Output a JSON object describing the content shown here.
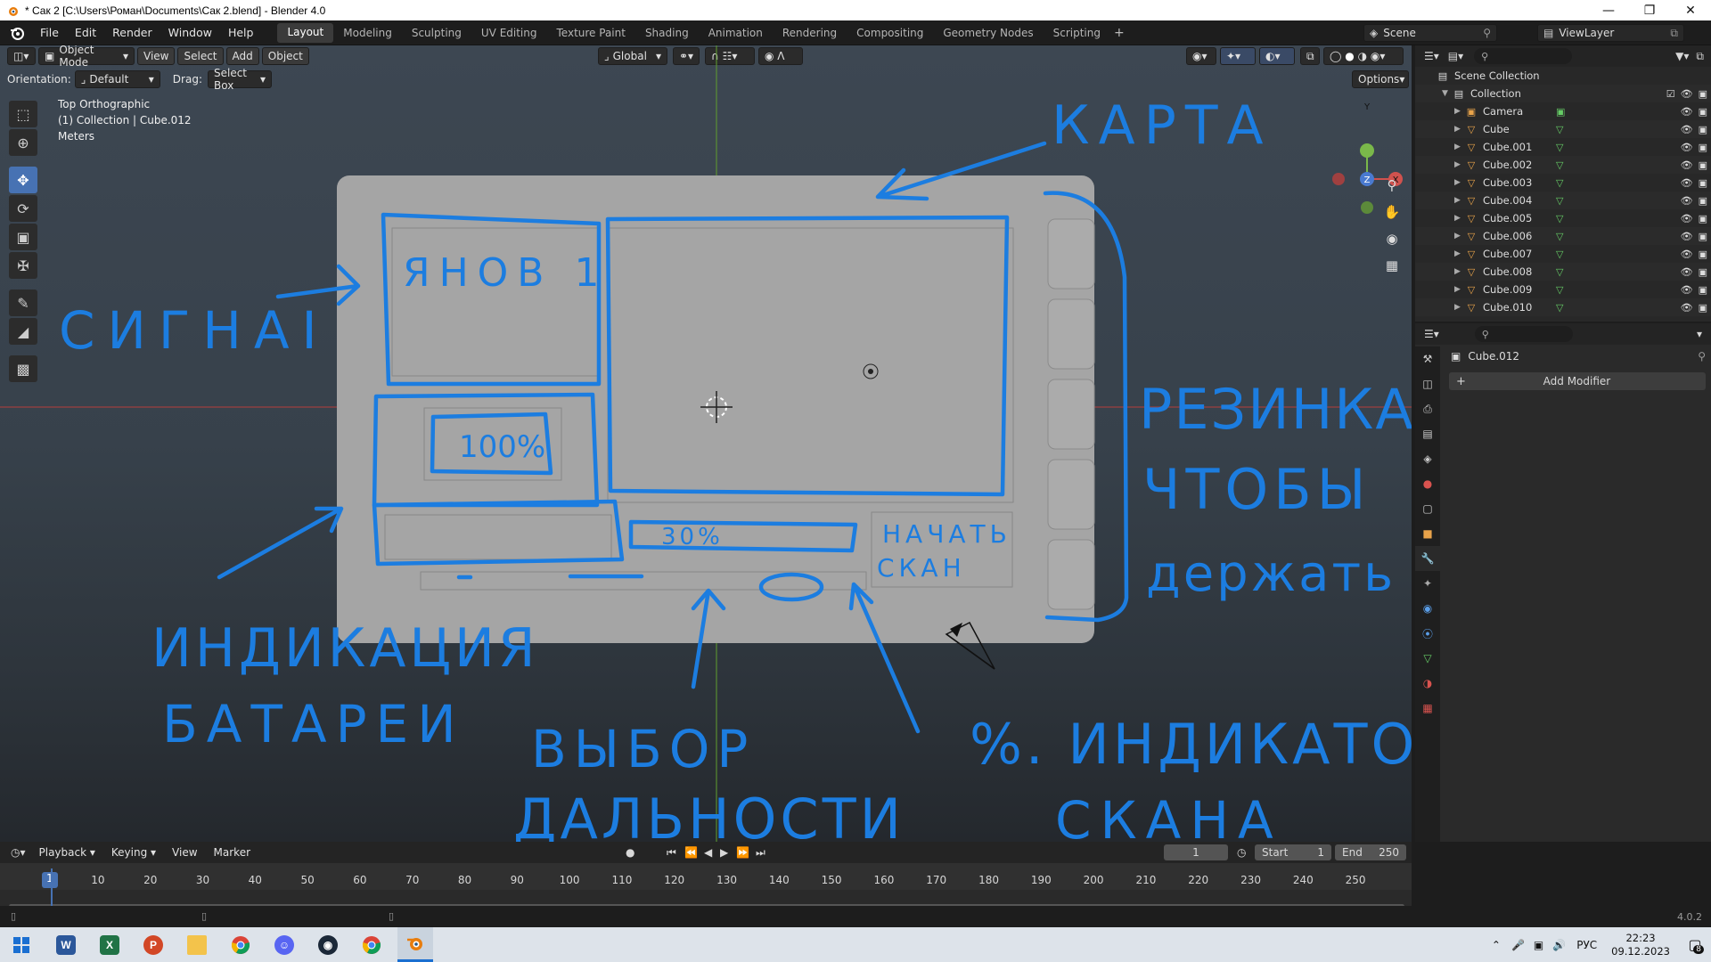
{
  "window": {
    "title": "* Сак 2 [C:\\Users\\Роман\\Documents\\Сак 2.blend] - Blender 4.0"
  },
  "menu": [
    "File",
    "Edit",
    "Render",
    "Window",
    "Help"
  ],
  "workspaces": [
    "Layout",
    "Modeling",
    "Sculpting",
    "UV Editing",
    "Texture Paint",
    "Shading",
    "Animation",
    "Rendering",
    "Compositing",
    "Geometry Nodes",
    "Scripting"
  ],
  "active_workspace": "Layout",
  "scene": {
    "name": "Scene",
    "view_layer": "ViewLayer"
  },
  "viewport": {
    "mode": "Object Mode",
    "menus": [
      "View",
      "Select",
      "Add",
      "Object"
    ],
    "orientation_label": "Orientation:",
    "orientation_value": "Default",
    "drag_label": "Drag:",
    "drag_value": "Select Box",
    "transform_space": "Global",
    "options_label": "Options",
    "info": {
      "view": "Top Orthographic",
      "collection": "(1) Collection | Cube.012",
      "units": "Meters"
    },
    "gizmo": {
      "y": "Y",
      "z": "Z",
      "x": "X"
    }
  },
  "sketch": {
    "card_label": "КАРТА",
    "signal_label": "СИГНАI",
    "channel_text": "ЯНОВ 1",
    "battery_percent": "100%",
    "range_percent": "30%",
    "start_scan": [
      "НАЧАТЬ",
      "СКАН"
    ],
    "battery_caption": [
      "ИНДИКАЦИЯ",
      "БАТАРЕИ"
    ],
    "range_caption": [
      "ВЫБОР",
      "ДАЛЬНОСТИ"
    ],
    "scan_caption": [
      "%. ИНДИКАТОР",
      "СКАНА"
    ],
    "rubber_caption": [
      "РЕЗИНКА,",
      "ЧТОБЫ",
      "держать"
    ]
  },
  "outliner": {
    "root": "Scene Collection",
    "collection": "Collection",
    "items": [
      "Camera",
      "Cube",
      "Cube.001",
      "Cube.002",
      "Cube.003",
      "Cube.004",
      "Cube.005",
      "Cube.006",
      "Cube.007",
      "Cube.008",
      "Cube.009",
      "Cube.010"
    ]
  },
  "properties": {
    "object": "Cube.012",
    "add_modifier": "Add Modifier"
  },
  "timeline": {
    "menus": [
      "Playback",
      "Keying",
      "View",
      "Marker"
    ],
    "current_frame": "1",
    "start_label": "Start",
    "start": "1",
    "end_label": "End",
    "end": "250",
    "ticks": [
      "1",
      "10",
      "20",
      "30",
      "40",
      "50",
      "60",
      "70",
      "80",
      "90",
      "100",
      "110",
      "120",
      "130",
      "140",
      "150",
      "160",
      "170",
      "180",
      "190",
      "200",
      "210",
      "220",
      "230",
      "240",
      "250"
    ]
  },
  "status": {
    "version": "4.0.2"
  },
  "taskbar": {
    "lang": "РУС",
    "time": "22:23",
    "date": "09.12.2023",
    "notifications": "8",
    "apps": [
      "windows-start",
      "word",
      "excel",
      "powerpoint",
      "explorer",
      "chrome",
      "discord",
      "steam",
      "chrome-alt",
      "blender"
    ]
  },
  "colors": {
    "accent": "#4772b3",
    "sketch": "#1c7de0",
    "active_tab": "#3b3b3b"
  }
}
